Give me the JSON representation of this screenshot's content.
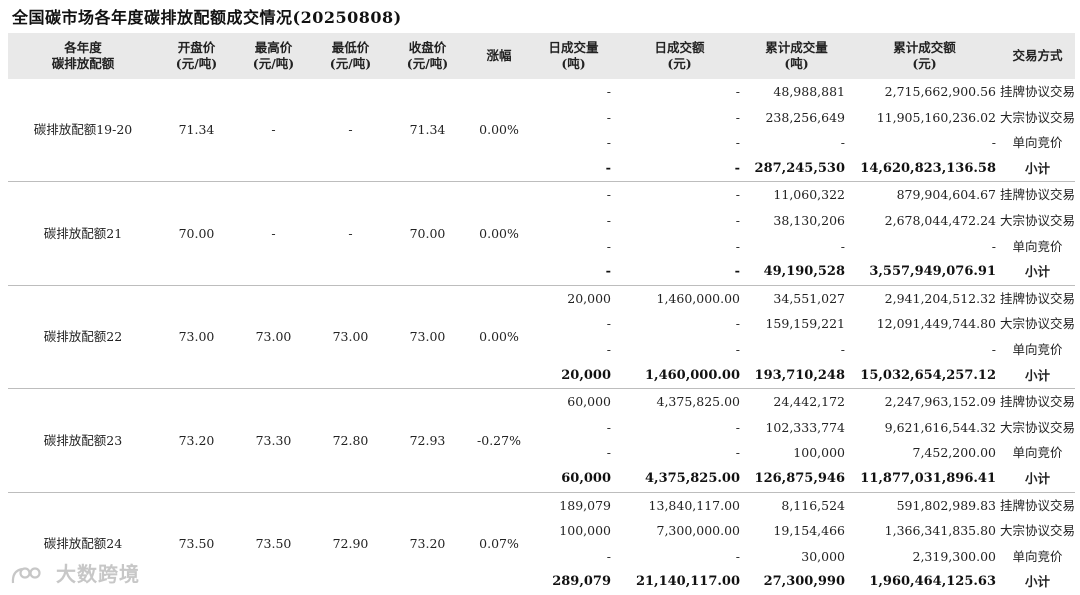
{
  "title": "全国碳市场各年度碳排放配额成交情况(20250808)",
  "headers": [
    "各年度\n碳排放配额",
    "开盘价\n(元/吨)",
    "最高价\n(元/吨)",
    "最低价\n(元/吨)",
    "收盘价\n(元/吨)",
    "涨幅",
    "日成交量\n(吨)",
    "日成交额\n(元)",
    "累计成交量\n(吨)",
    "累计成交额\n(元)",
    "交易方式"
  ],
  "groups": [
    {
      "name": "碳排放配额19-20",
      "open": "71.34",
      "high": "-",
      "low": "-",
      "close": "71.34",
      "change": "0.00%",
      "rows": [
        {
          "dvol": "-",
          "damt": "-",
          "cvol": "48,988,881",
          "camt": "2,715,662,900.56",
          "way": "挂牌协议交易"
        },
        {
          "dvol": "-",
          "damt": "-",
          "cvol": "238,256,649",
          "camt": "11,905,160,236.02",
          "way": "大宗协议交易"
        },
        {
          "dvol": "-",
          "damt": "-",
          "cvol": "-",
          "camt": "-",
          "way": "单向竞价"
        },
        {
          "dvol": "-",
          "damt": "-",
          "cvol": "287,245,530",
          "camt": "14,620,823,136.58",
          "way": "小计"
        }
      ]
    },
    {
      "name": "碳排放配额21",
      "open": "70.00",
      "high": "-",
      "low": "-",
      "close": "70.00",
      "change": "0.00%",
      "rows": [
        {
          "dvol": "-",
          "damt": "-",
          "cvol": "11,060,322",
          "camt": "879,904,604.67",
          "way": "挂牌协议交易"
        },
        {
          "dvol": "-",
          "damt": "-",
          "cvol": "38,130,206",
          "camt": "2,678,044,472.24",
          "way": "大宗协议交易"
        },
        {
          "dvol": "-",
          "damt": "-",
          "cvol": "-",
          "camt": "-",
          "way": "单向竞价"
        },
        {
          "dvol": "-",
          "damt": "-",
          "cvol": "49,190,528",
          "camt": "3,557,949,076.91",
          "way": "小计"
        }
      ]
    },
    {
      "name": "碳排放配额22",
      "open": "73.00",
      "high": "73.00",
      "low": "73.00",
      "close": "73.00",
      "change": "0.00%",
      "rows": [
        {
          "dvol": "20,000",
          "damt": "1,460,000.00",
          "cvol": "34,551,027",
          "camt": "2,941,204,512.32",
          "way": "挂牌协议交易"
        },
        {
          "dvol": "-",
          "damt": "-",
          "cvol": "159,159,221",
          "camt": "12,091,449,744.80",
          "way": "大宗协议交易"
        },
        {
          "dvol": "-",
          "damt": "-",
          "cvol": "-",
          "camt": "-",
          "way": "单向竞价"
        },
        {
          "dvol": "20,000",
          "damt": "1,460,000.00",
          "cvol": "193,710,248",
          "camt": "15,032,654,257.12",
          "way": "小计"
        }
      ]
    },
    {
      "name": "碳排放配额23",
      "open": "73.20",
      "high": "73.30",
      "low": "72.80",
      "close": "72.93",
      "change": "-0.27%",
      "rows": [
        {
          "dvol": "60,000",
          "damt": "4,375,825.00",
          "cvol": "24,442,172",
          "camt": "2,247,963,152.09",
          "way": "挂牌协议交易"
        },
        {
          "dvol": "-",
          "damt": "-",
          "cvol": "102,333,774",
          "camt": "9,621,616,544.32",
          "way": "大宗协议交易"
        },
        {
          "dvol": "-",
          "damt": "-",
          "cvol": "100,000",
          "camt": "7,452,200.00",
          "way": "单向竞价"
        },
        {
          "dvol": "60,000",
          "damt": "4,375,825.00",
          "cvol": "126,875,946",
          "camt": "11,877,031,896.41",
          "way": "小计"
        }
      ]
    },
    {
      "name": "碳排放配额24",
      "open": "73.50",
      "high": "73.50",
      "low": "72.90",
      "close": "73.20",
      "change": "0.07%",
      "rows": [
        {
          "dvol": "189,079",
          "damt": "13,840,117.00",
          "cvol": "8,116,524",
          "camt": "591,802,989.83",
          "way": "挂牌协议交易"
        },
        {
          "dvol": "100,000",
          "damt": "7,300,000.00",
          "cvol": "19,154,466",
          "camt": "1,366,341,835.80",
          "way": "大宗协议交易"
        },
        {
          "dvol": "-",
          "damt": "-",
          "cvol": "30,000",
          "camt": "2,319,300.00",
          "way": "单向竞价"
        },
        {
          "dvol": "289,079",
          "damt": "21,140,117.00",
          "cvol": "27,300,990",
          "camt": "1,960,464,125.63",
          "way": "小计"
        }
      ]
    }
  ],
  "watermark": "大数跨境",
  "colors": {
    "header_bg": "#e9e9e9",
    "divider": "#bdbdbd",
    "watermark": "#c7c7c7"
  }
}
